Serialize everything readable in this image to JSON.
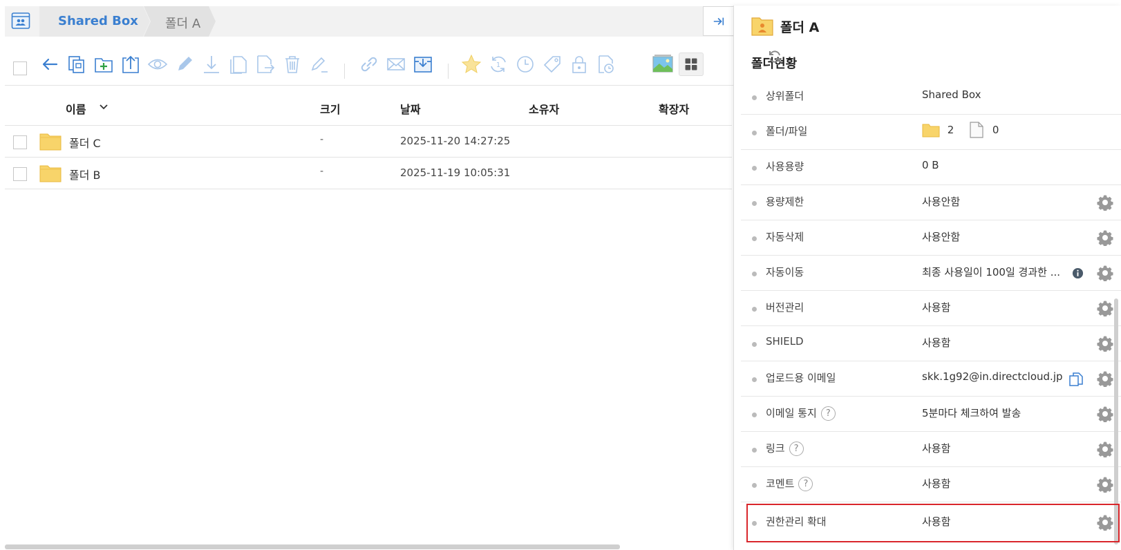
{
  "breadcrumb": {
    "root": "Shared Box",
    "current": "폴더 A"
  },
  "toolbar": {
    "icons": [
      "back-arrow-icon",
      "copy-icon",
      "new-folder-icon",
      "upload-icon",
      "preview-icon",
      "edit-icon",
      "download-icon",
      "duplicate-icon",
      "move-icon",
      "delete-icon",
      "rename-icon",
      "link-icon",
      "mail-icon",
      "inbox-icon",
      "star-icon",
      "sync-icon",
      "history-icon",
      "tag-icon",
      "lock-icon",
      "schedule-icon",
      "thumbnail-view-icon",
      "grid-view-icon"
    ]
  },
  "table": {
    "columns": {
      "name": "이름",
      "size": "크기",
      "date": "날짜",
      "owner": "소유자",
      "ext": "확장자"
    },
    "rows": [
      {
        "name": "폴더 C",
        "size": "-",
        "date": "2025-11-20 14:27:25"
      },
      {
        "name": "폴더 B",
        "size": "-",
        "date": "2025-11-19 10:05:31"
      }
    ]
  },
  "panel": {
    "title": "폴더 A",
    "subtitle": "폴더현황",
    "rows": [
      {
        "label": "상위폴더",
        "value": "Shared Box"
      },
      {
        "label": "폴더/파일",
        "folders": "2",
        "files": "0"
      },
      {
        "label": "사용용량",
        "value": "0 B"
      },
      {
        "label": "용량제한",
        "value": "사용안함"
      },
      {
        "label": "자동삭제",
        "value": "사용안함"
      },
      {
        "label": "자동이동",
        "value": "최종 사용일이 100일 경과한 ..."
      },
      {
        "label": "버전관리",
        "value": "사용함"
      },
      {
        "label": "SHIELD",
        "value": "사용함"
      },
      {
        "label": "업로드용 이메일",
        "value": "skk.1g92@in.directcloud.jp"
      },
      {
        "label": "이메일 통지",
        "value": "5분마다 체크하여 발송"
      },
      {
        "label": "링크",
        "value": "사용함"
      },
      {
        "label": "코멘트",
        "value": "사용함"
      },
      {
        "label": "권한관리 확대",
        "value": "사용함"
      }
    ],
    "help_mark": "?"
  },
  "colors": {
    "accent": "#3a7fd0",
    "folder": "#f8d46a",
    "highlight": "#d9262b"
  }
}
